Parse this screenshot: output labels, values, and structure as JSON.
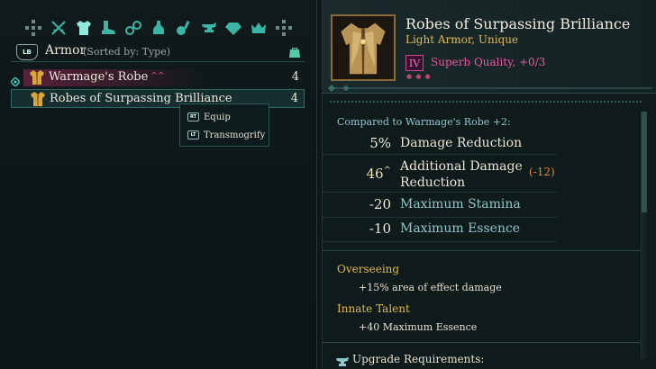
{
  "categories": [
    {
      "name": "quick-slot-icon"
    },
    {
      "name": "weapons-icon"
    },
    {
      "name": "armor-icon"
    },
    {
      "name": "boots-icon"
    },
    {
      "name": "accessories-icon"
    },
    {
      "name": "consumables-icon"
    },
    {
      "name": "alchemy-icon"
    },
    {
      "name": "crafting-icon"
    },
    {
      "name": "gems-icon"
    },
    {
      "name": "crowns-icon"
    },
    {
      "name": "misc-icon"
    }
  ],
  "section": {
    "button": "LB",
    "title": "Armor",
    "sort_label": "(Sorted by: Type)"
  },
  "items": [
    {
      "name": "Warmage's Robe",
      "mark": "^^",
      "count": "4"
    },
    {
      "name": "Robes of Surpassing Brilliance",
      "count": "4"
    }
  ],
  "context_menu": {
    "equip_button": "RT",
    "equip_label": "Equip",
    "transmog_button": "LT",
    "transmog_label": "Transmogrify"
  },
  "detail": {
    "title": "Robes of Surpassing Brilliance",
    "subtitle": "Light Armor, Unique",
    "quality_badge": "IV",
    "quality_text": "Superb Quality, +0/3",
    "quality_dots": "● ● ●",
    "compare_label": "Compared to Warmage's Robe +2:",
    "stats": [
      {
        "value": "5%",
        "label": "Damage Reduction"
      },
      {
        "value": "46",
        "marker": "^",
        "label": "Additional Damage Reduction",
        "delta": "(-12)"
      },
      {
        "value": "-20",
        "label": "Maximum Stamina"
      },
      {
        "value": "-10",
        "label": "Maximum Essence"
      }
    ],
    "traits": [
      {
        "name": "Overseeing",
        "desc": "+15% area of effect damage"
      },
      {
        "name": "Innate Talent",
        "desc": "+40 Maximum Essence"
      }
    ],
    "upgrade_label": "Upgrade Requirements:"
  },
  "colors": {
    "accent": "#3bb5a6",
    "gold": "#e0b94c",
    "quality": "#e35aa2",
    "negative": "#8fc6cb",
    "delta": "#e08a2a"
  }
}
